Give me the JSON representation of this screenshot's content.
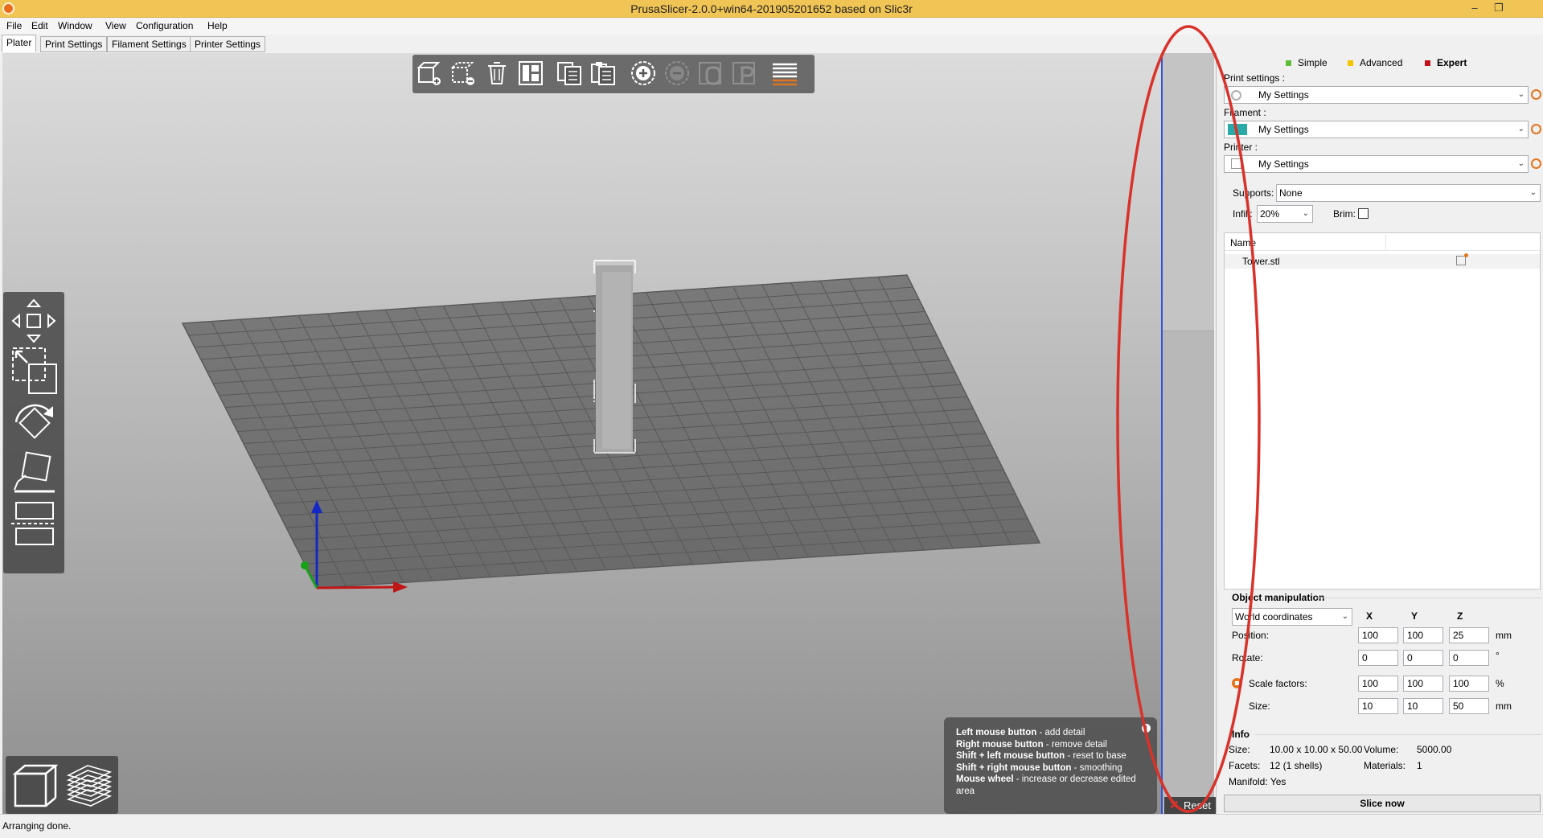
{
  "window": {
    "title": "PrusaSlicer-2.0.0+win64-201905201652 based on Slic3r",
    "minimize": "–",
    "restore": "❐"
  },
  "menu": [
    "File",
    "Edit",
    "Window",
    "View",
    "Configuration",
    "Help"
  ],
  "tabs": [
    "Plater",
    "Print Settings",
    "Filament Settings",
    "Printer Settings"
  ],
  "modes": {
    "simple": "Simple",
    "advanced": "Advanced",
    "expert": "Expert"
  },
  "mode_colors": {
    "simple": "#5fbf3a",
    "advanced": "#f2c500",
    "expert": "#c0101a"
  },
  "presets": {
    "print_label": "Print settings :",
    "print_value": "My Settings",
    "filament_label": "Filament :",
    "filament_value": "My Settings",
    "filament_color": "#2aa9a9",
    "printer_label": "Printer :",
    "printer_value": "My Settings"
  },
  "options": {
    "supports_label": "Supports:",
    "supports_value": "None",
    "infill_label": "Infill:",
    "infill_value": "20%",
    "brim_label": "Brim:"
  },
  "object_list": {
    "header": "Name",
    "items": [
      "Tower.stl"
    ]
  },
  "object_manipulation": {
    "title": "Object manipulation",
    "coord_system": "World coordinates",
    "axes": [
      "X",
      "Y",
      "Z"
    ],
    "position_label": "Position:",
    "position": [
      "100",
      "100",
      "25"
    ],
    "position_unit": "mm",
    "rotate_label": "Rotate:",
    "rotate": [
      "0",
      "0",
      "0"
    ],
    "rotate_unit": "°",
    "scale_label": "Scale factors:",
    "scale": [
      "100",
      "100",
      "100"
    ],
    "scale_unit": "%",
    "size_label": "Size:",
    "size": [
      "10",
      "10",
      "50"
    ],
    "size_unit": "mm"
  },
  "info": {
    "title": "Info",
    "size_label": "Size:",
    "size_value": "10.00 x 10.00 x 50.00",
    "volume_label": "Volume:",
    "volume_value": "5000.00",
    "facets_label": "Facets:",
    "facets_value": "12 (1 shells)",
    "materials_label": "Materials:",
    "materials_value": "1",
    "manifold_label": "Manifold:",
    "manifold_value": "Yes"
  },
  "slice_button": "Slice now",
  "reset_button": "Reset",
  "hints": [
    {
      "key": "Left mouse button",
      "text": " - add detail"
    },
    {
      "key": "Right mouse button",
      "text": " - remove detail"
    },
    {
      "key": "Shift + left mouse button",
      "text": " - reset to base"
    },
    {
      "key": "Shift + right mouse button",
      "text": " - smoothing"
    },
    {
      "key": "Mouse wheel",
      "text": " - increase or decrease edited area"
    }
  ],
  "status": "Arranging done.",
  "annotation_color": "#d9322a"
}
